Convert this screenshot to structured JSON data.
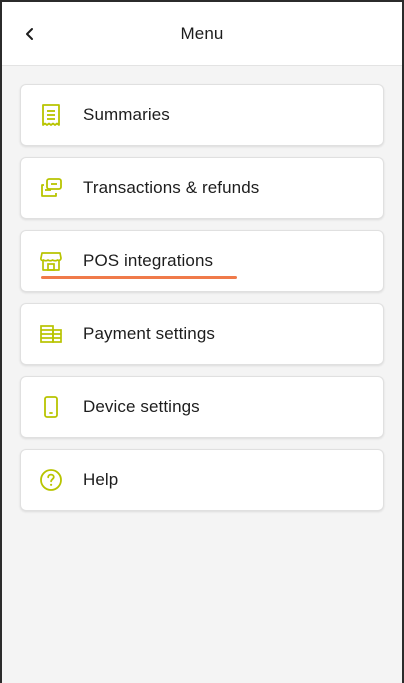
{
  "header": {
    "title": "Menu",
    "back_icon": "chevron-left-icon"
  },
  "menu": {
    "items": [
      {
        "label": "Summaries",
        "icon": "receipt-icon"
      },
      {
        "label": "Transactions & refunds",
        "icon": "cards-icon"
      },
      {
        "label": "POS integrations",
        "icon": "storefront-icon",
        "highlighted": true
      },
      {
        "label": "Payment settings",
        "icon": "stacked-cards-icon"
      },
      {
        "label": "Device settings",
        "icon": "phone-icon"
      },
      {
        "label": "Help",
        "icon": "question-circle-icon"
      }
    ]
  },
  "colors": {
    "icon_accent": "#b8c400",
    "highlight_underline": "#f07a4a",
    "background": "#f4f4f4",
    "card": "#ffffff",
    "text": "#1d1d1d"
  }
}
